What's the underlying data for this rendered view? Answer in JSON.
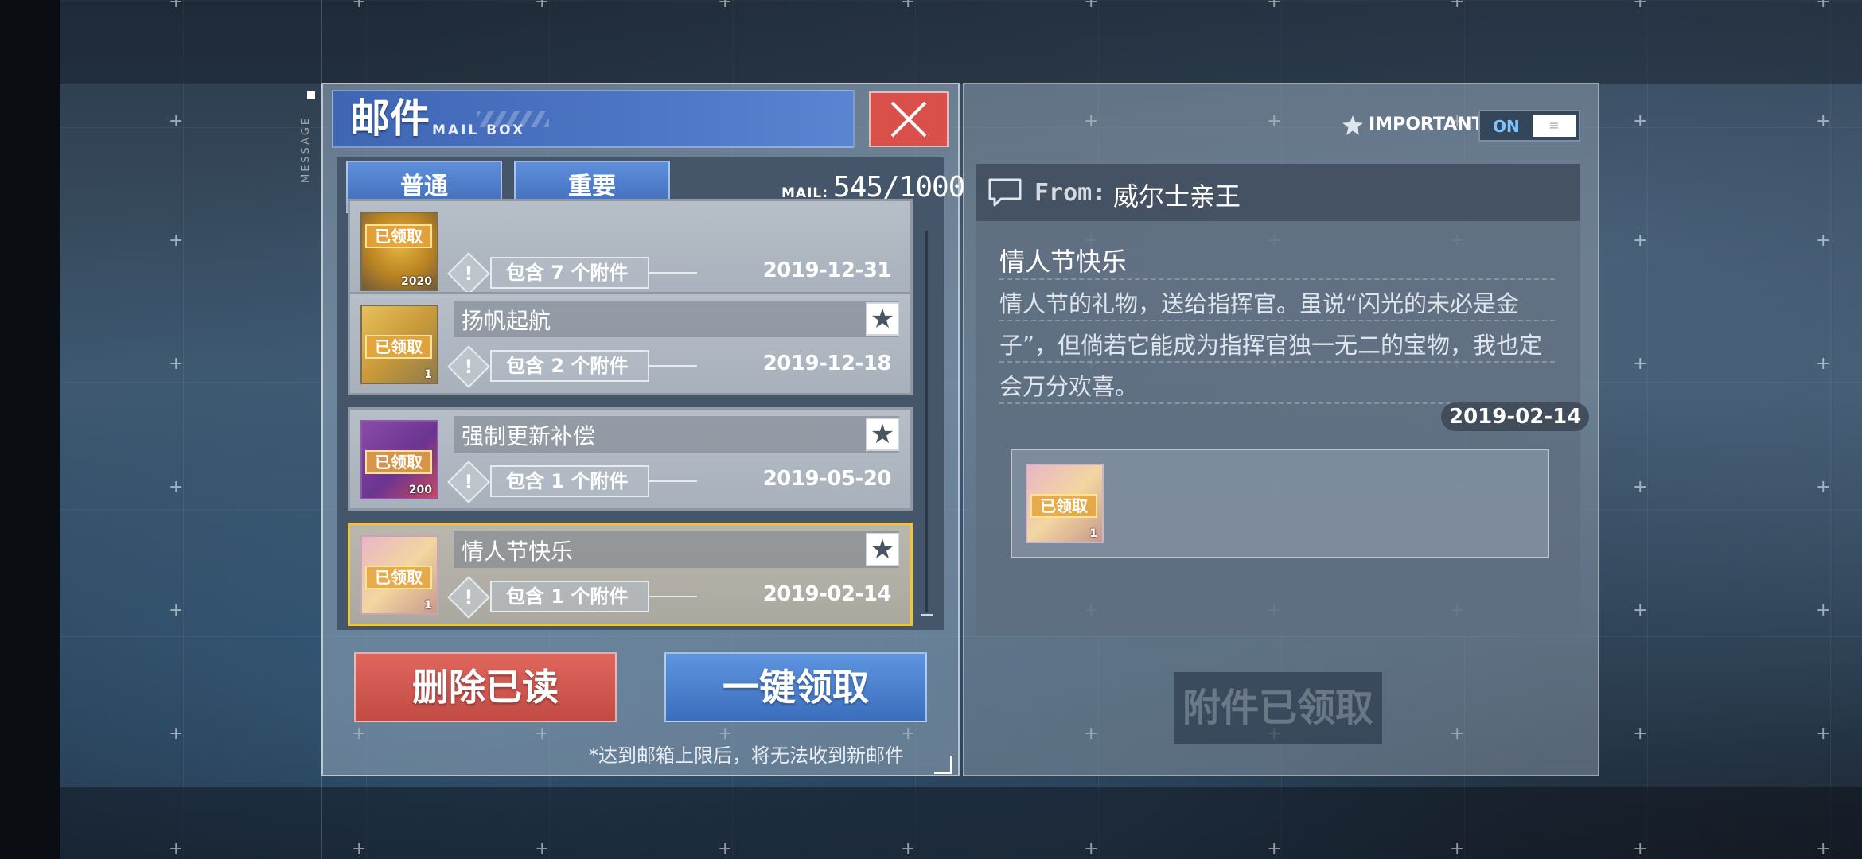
{
  "side_label": "MESSAGE",
  "header": {
    "title": "邮件",
    "subtitle": "MAIL BOX"
  },
  "tabs": [
    {
      "label": "普通"
    },
    {
      "label": "重要"
    }
  ],
  "mail_count": {
    "label": "MAIL:",
    "value": "545/1000"
  },
  "mails": [
    {
      "title": "",
      "thumb_badge": "已领取",
      "thumb_count": "2020",
      "attachments": "包含 7 个附件",
      "date": "2019-12-31",
      "starred": false
    },
    {
      "title": "扬帆起航",
      "thumb_badge": "已领取",
      "thumb_count": "1",
      "attachments": "包含 2 个附件",
      "date": "2019-12-18",
      "starred": true
    },
    {
      "title": "强制更新补偿",
      "thumb_badge": "已领取",
      "thumb_count": "200",
      "attachments": "包含 1 个附件",
      "date": "2019-05-20",
      "starred": true
    },
    {
      "title": "情人节快乐",
      "thumb_badge": "已领取",
      "thumb_count": "1",
      "attachments": "包含 1 个附件",
      "date": "2019-02-14",
      "starred": true,
      "selected": true
    }
  ],
  "actions": {
    "delete_read": "删除已读",
    "collect_all": "一键领取",
    "limit_note": "*达到邮箱上限后，将无法收到新邮件"
  },
  "important_filter": {
    "label": "IMPORTANT",
    "state": "ON"
  },
  "detail": {
    "from_prefix": "From:",
    "sender": "威尔士亲王",
    "title": "情人节快乐",
    "body": "情人节的礼物，送给指挥官。虽说“闪光的未必是金子”，但倘若它能成为指挥官独一无二的宝物，我也定会万分欢喜。",
    "date": "2019-02-14",
    "attachment_badge": "已领取",
    "attachment_count": "1",
    "collected_label": "附件已领取"
  },
  "colors": {
    "accent_blue": "#4c76c6",
    "close_red": "#d9504a",
    "selected_border": "#f3c530"
  }
}
